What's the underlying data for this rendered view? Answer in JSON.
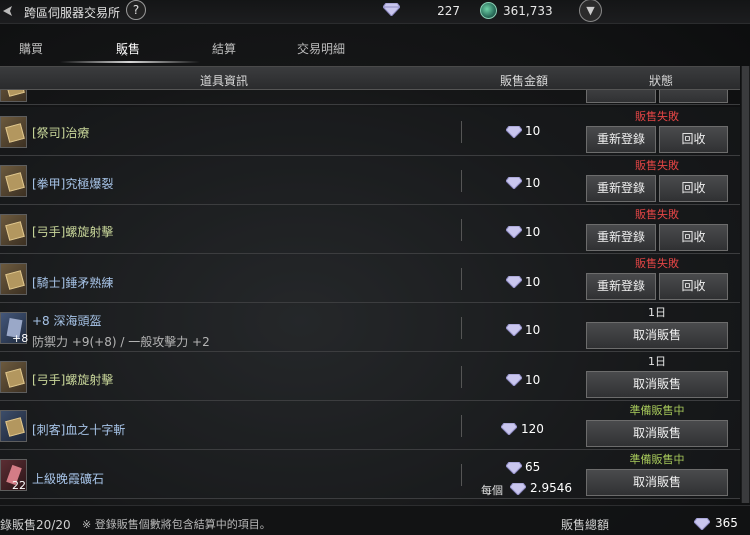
{
  "header": {
    "title": "跨區伺服器交易所",
    "help_label": "?",
    "gem_count": "227",
    "coin_count": "361,733"
  },
  "tabs": [
    {
      "label": "購買"
    },
    {
      "label": "販售"
    },
    {
      "label": "結算"
    },
    {
      "label": "交易明細"
    }
  ],
  "columns": {
    "item": "道具資訊",
    "price": "販售金額",
    "status": "狀態"
  },
  "rows": [
    {
      "name": "[祭司]治療",
      "price": "10",
      "status": "販售失敗",
      "btn1": "重新登錄",
      "btn2": "回收"
    },
    {
      "name": "[拳甲]究極爆裂",
      "price": "10",
      "status": "販售失敗",
      "btn1": "重新登錄",
      "btn2": "回收"
    },
    {
      "name": "[弓手]螺旋射擊",
      "price": "10",
      "status": "販售失敗",
      "btn1": "重新登錄",
      "btn2": "回收"
    },
    {
      "name": "[騎士]錘矛熟練",
      "price": "10",
      "status": "販售失敗",
      "btn1": "重新登錄",
      "btn2": "回收"
    },
    {
      "name": "+8 深海頭盔",
      "sub": "防禦力 +9(+8) / 一般攻擊力 +2",
      "qty": "+8",
      "price": "10",
      "status": "1日",
      "btn1": "取消販售"
    },
    {
      "name": "[弓手]螺旋射擊",
      "price": "10",
      "status": "1日",
      "btn1": "取消販售"
    },
    {
      "name": "[刺客]血之十字斬",
      "price": "120",
      "status": "準備販售中",
      "btn1": "取消販售"
    },
    {
      "name": "上級晚霞礦石",
      "qty": "22",
      "price": "65",
      "per_label": "每個",
      "per_price": "2.9546",
      "status": "準備販售中",
      "btn1": "取消販售"
    }
  ],
  "footer": {
    "count": "錄販售20/20",
    "note": "※ 登錄販售個數將包含結算中的項目。",
    "total_label": "販售總額",
    "total": "365"
  },
  "colors": {
    "fail": "#e24545",
    "ready": "#a6c85a",
    "name_blue": "#a7c4e8"
  }
}
